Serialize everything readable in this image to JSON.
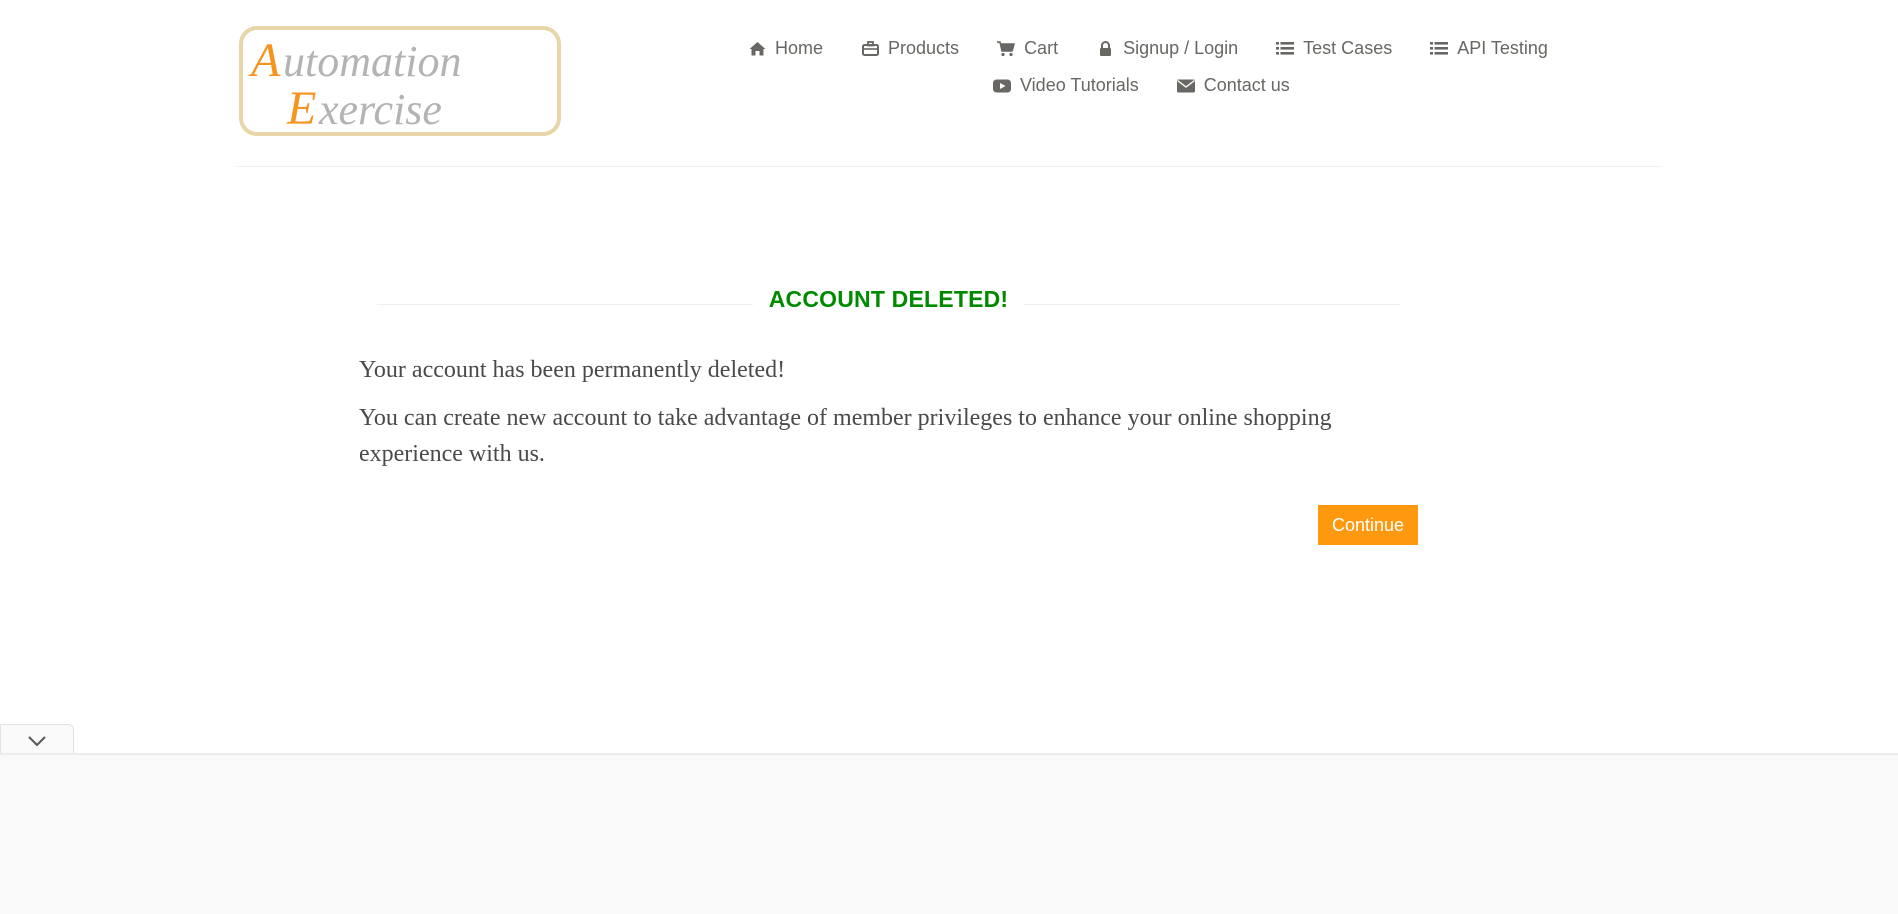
{
  "header": {
    "logo": {
      "line1": "Automation",
      "line2": "Exercise",
      "accent": "#f7941d",
      "text_color": "#b3b3b3"
    },
    "nav": [
      {
        "label": "Home",
        "icon": "home-icon"
      },
      {
        "label": "Products",
        "icon": "briefcase-icon"
      },
      {
        "label": "Cart",
        "icon": "cart-icon"
      },
      {
        "label": "Signup / Login",
        "icon": "lock-icon"
      },
      {
        "label": "Test Cases",
        "icon": "list-icon"
      },
      {
        "label": "API Testing",
        "icon": "list-icon"
      },
      {
        "label": "Video Tutorials",
        "icon": "youtube-play-icon"
      },
      {
        "label": "Contact us",
        "icon": "envelope-icon"
      }
    ]
  },
  "main": {
    "title": "ACCOUNT DELETED!",
    "message1": "Your account has been permanently deleted!",
    "message2": "You can create new account to take advantage of member privileges to enhance your online shopping experience with us.",
    "continue_label": "Continue"
  },
  "colors": {
    "accent": "#fe980f",
    "success": "#008a00",
    "text": "#696763"
  }
}
